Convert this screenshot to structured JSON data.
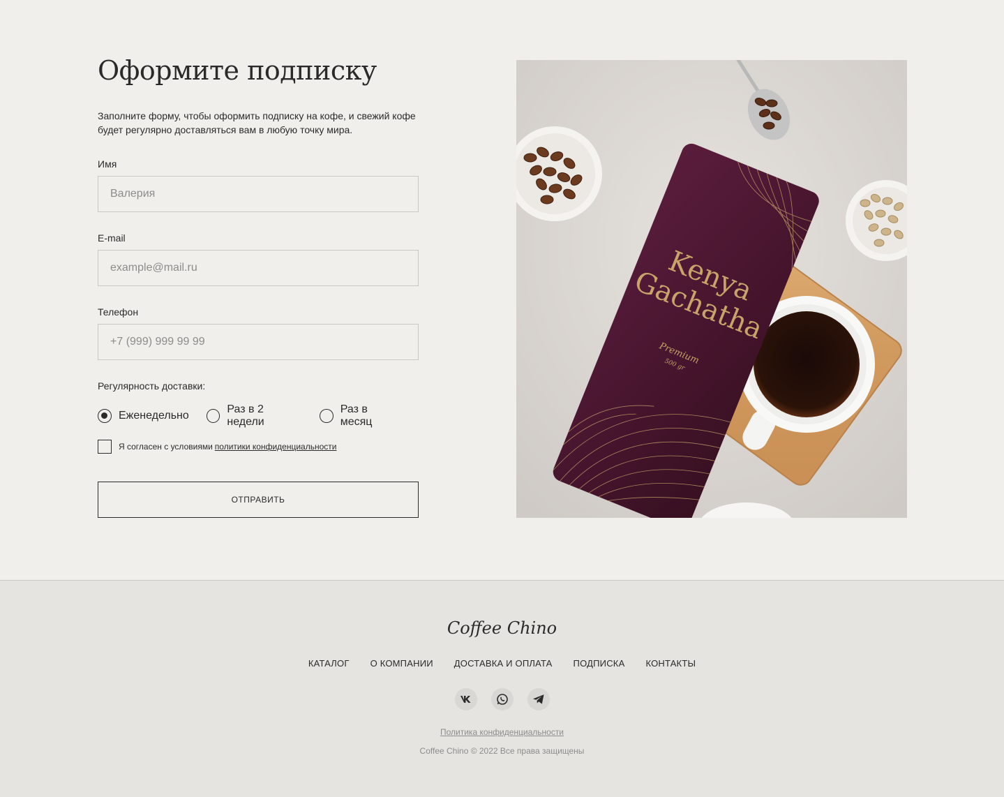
{
  "form": {
    "title": "Оформите подписку",
    "lead": "Заполните форму, чтобы оформить подписку на кофе, и свежий кофе будет регулярно доставляться вам в любую точку мира.",
    "name": {
      "label": "Имя",
      "placeholder": "Валерия"
    },
    "email": {
      "label": "E-mail",
      "placeholder": "example@mail.ru"
    },
    "phone": {
      "label": "Телефон",
      "placeholder": "+7 (999) 999 99 99"
    },
    "frequency": {
      "label": "Регулярность доставки:",
      "options": [
        "Еженедельно",
        "Раз в 2 недели",
        "Раз в месяц"
      ],
      "selected": "Еженедельно"
    },
    "consent": {
      "text": "Я согласен с условиями",
      "link": "политики конфиденциальности",
      "checked": false
    },
    "submit_label": "ОТПРАВИТЬ"
  },
  "photo": {
    "package_name_line1": "Kenya",
    "package_name_line2": "Gachatha",
    "package_grade": "Premium",
    "package_weight": "500 gr"
  },
  "footer": {
    "logo": "Coffee Chino",
    "nav": [
      "КАТАЛОГ",
      "О КОМПАНИИ",
      "ДОСТАВКА И ОПЛАТА",
      "ПОДПИСКА",
      "КОНТАКТЫ"
    ],
    "socials": [
      "vk-icon",
      "whatsapp-icon",
      "telegram-icon"
    ],
    "policy": "Политика конфиденциальности",
    "copyright": "Coffee Chino © 2022 Все права защищены"
  },
  "colors": {
    "background": "#f0efeb",
    "footer_bg": "#e5e4e0",
    "text": "#2a2a2a",
    "muted": "#8c8c8a",
    "package": "#4a1830",
    "gold": "#c9a46a"
  }
}
